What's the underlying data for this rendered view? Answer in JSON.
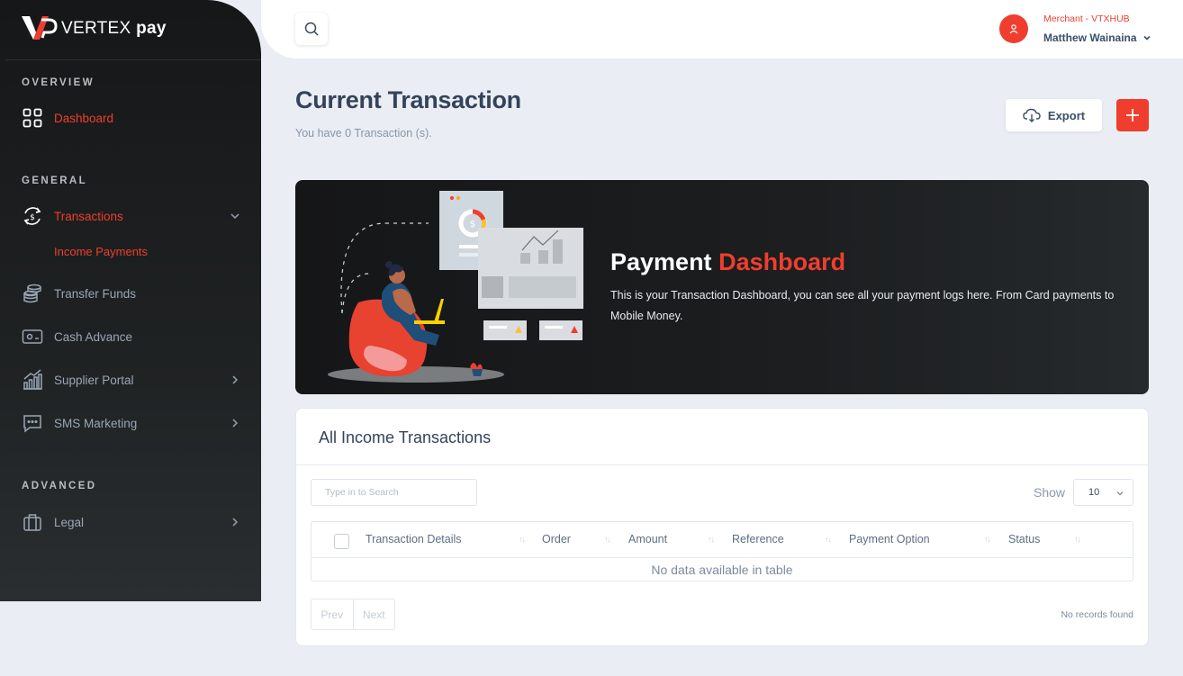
{
  "brand": {
    "name_light": "VERTEX",
    "name_bold": "pay"
  },
  "sidebar": {
    "overview_title": "OVERVIEW",
    "general_title": "GENERAL",
    "advanced_title": "ADVANCED",
    "items": {
      "dashboard": "Dashboard",
      "transactions": "Transactions",
      "income_payments": "Income Payments",
      "transfer_funds": "Transfer Funds",
      "cash_advance": "Cash Advance",
      "supplier_portal": "Supplier Portal",
      "sms_marketing": "SMS Marketing",
      "legal": "Legal"
    }
  },
  "header": {
    "merchant": "Merchant - VTXHUB",
    "user_name": "Matthew Wainaina"
  },
  "page": {
    "title": "Current Transaction",
    "subtitle": "You have 0 Transaction (s).",
    "export_label": "Export"
  },
  "banner": {
    "title_plain": "Payment",
    "title_accent": "Dashboard",
    "text": "This is your Transaction Dashboard, you can see all your payment logs here. From Card payments to Mobile Money."
  },
  "table_card": {
    "title": "All Income Transactions",
    "search_placeholder": "Type in to Search",
    "show_label": "Show",
    "page_size": "10",
    "columns": [
      "Transaction Details",
      "Order",
      "Amount",
      "Reference",
      "Payment Option",
      "Status"
    ],
    "empty_text": "No data available in table",
    "prev_label": "Prev",
    "next_label": "Next",
    "records_text": "No records found"
  },
  "colors": {
    "accent": "#ef3e2e",
    "sidebar_bg": "#1b1d1e",
    "page_bg": "#eaeef4"
  }
}
